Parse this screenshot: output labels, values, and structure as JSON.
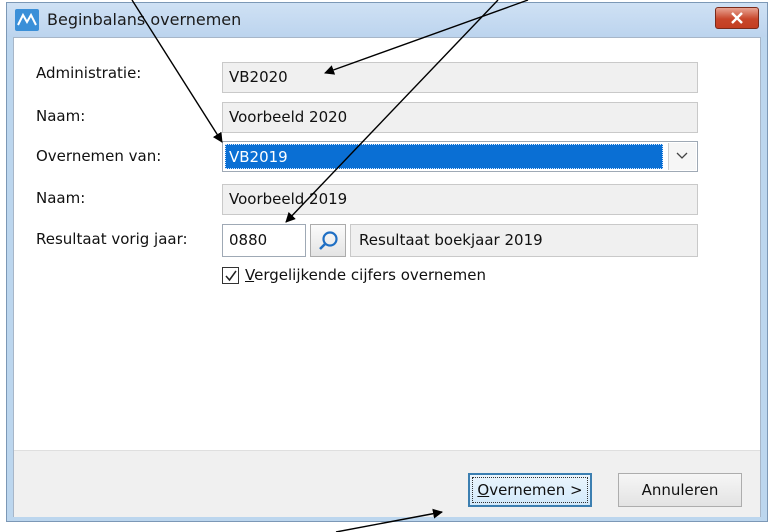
{
  "window": {
    "title": "Beginbalans overnemen"
  },
  "form": {
    "administratie_label": "Administratie:",
    "administratie_value": "VB2020",
    "naam1_label": "Naam:",
    "naam1_value": "Voorbeeld 2020",
    "overnemen_van_label": "Overnemen van:",
    "overnemen_van_value": "VB2019",
    "naam2_label": "Naam:",
    "naam2_value": "Voorbeeld 2019",
    "resultaat_label": "Resultaat vorig jaar:",
    "resultaat_code": "0880",
    "resultaat_name": "Resultaat boekjaar 2019",
    "vergelijkende_accel": "V",
    "vergelijkende_rest": "ergelijkende cijfers overnemen",
    "vergelijkende_checked": true
  },
  "buttons": {
    "overnemen_accel": "O",
    "overnemen_rest": "vernemen >",
    "annuleren": "Annuleren"
  },
  "icons": {
    "app": "app-logo-icon",
    "close": "close-icon",
    "dropdown": "chevron-down-icon",
    "lookup": "search-icon",
    "check": "checkmark-icon"
  },
  "colors": {
    "selection": "#0a6fd4",
    "titlebar": "#bcd6ee",
    "close": "#c8462b"
  }
}
